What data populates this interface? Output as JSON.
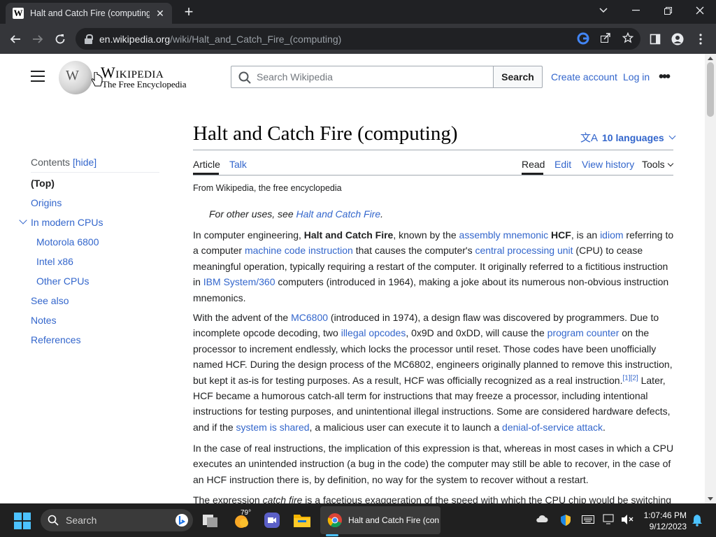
{
  "browser": {
    "tab_title": "Halt and Catch Fire (computing)",
    "tab_favicon": "W",
    "url_host": "en.wikipedia.org",
    "url_path": "/wiki/Halt_and_Catch_Fire_(computing)"
  },
  "wiki_header": {
    "wordmark": "Wikipedia",
    "tagline": "The Free Encyclopedia",
    "search_placeholder": "Search Wikipedia",
    "search_button": "Search",
    "create_account": "Create account",
    "log_in": "Log in",
    "more": "•••"
  },
  "toc": {
    "title": "Contents",
    "hide": "[hide]",
    "items": [
      "(Top)",
      "Origins",
      "In modern CPUs",
      "Motorola 6800",
      "Intel x86",
      "Other CPUs",
      "See also",
      "Notes",
      "References"
    ]
  },
  "article": {
    "title": "Halt and Catch Fire (computing)",
    "languages": "10 languages",
    "lang_icon": "文A",
    "tabs": {
      "article": "Article",
      "talk": "Talk",
      "read": "Read",
      "edit": "Edit",
      "history": "View history",
      "tools": "Tools"
    },
    "from_wikipedia": "From Wikipedia, the free encyclopedia",
    "hatnote_prefix": "For other uses, see ",
    "hatnote_link": "Halt and Catch Fire",
    "hatnote_suffix": ".",
    "p1": [
      {
        "t": "In computer engineering, "
      },
      {
        "t": "Halt and Catch Fire",
        "b": true
      },
      {
        "t": ", known by the "
      },
      {
        "t": "assembly mnemonic",
        "link": true
      },
      {
        "t": " "
      },
      {
        "t": "HCF",
        "b": true
      },
      {
        "t": ", is an "
      },
      {
        "t": "idiom",
        "link": true
      },
      {
        "t": " referring to a computer "
      },
      {
        "t": "machine code instruction",
        "link": true
      },
      {
        "t": " that causes the computer's "
      },
      {
        "t": "central processing unit",
        "link": true
      },
      {
        "t": " (CPU) to cease meaningful operation, typically requiring a restart of the computer. It originally referred to a fictitious instruction in "
      },
      {
        "t": "IBM System/360",
        "link": true
      },
      {
        "t": " computers (introduced in 1964), making a joke about its numerous non-obvious instruction mnemonics."
      }
    ],
    "p2": [
      {
        "t": "With the advent of the "
      },
      {
        "t": "MC6800",
        "link": true
      },
      {
        "t": " (introduced in 1974), a design flaw was discovered by programmers. Due to incomplete opcode decoding, two "
      },
      {
        "t": "illegal opcodes",
        "link": true
      },
      {
        "t": ", 0x9D and 0xDD, will cause the "
      },
      {
        "t": "program counter",
        "link": true
      },
      {
        "t": " on the processor to increment endlessly, which locks the processor until reset. Those codes have been unofficially named HCF. During the design process of the MC6802, engineers originally planned to remove this instruction, but kept it as-is for testing purposes. As a result, HCF was officially recognized as a real instruction."
      },
      {
        "t": "[1][2]",
        "sup": true
      },
      {
        "t": " Later, HCF became a humorous catch-all term for instructions that may freeze a processor, including intentional instructions for testing purposes, and unintentional illegal instructions. Some are considered hardware defects, and if the "
      },
      {
        "t": "system is shared",
        "link": true
      },
      {
        "t": ", a malicious user can execute it to launch a "
      },
      {
        "t": "denial-of-service attack",
        "link": true
      },
      {
        "t": "."
      }
    ],
    "p3": [
      {
        "t": "In the case of real instructions, the implication of this expression is that, whereas in most cases in which a CPU executes an unintended instruction (a bug in the code) the computer may still be able to recover, in the case of an HCF instruction there is, by definition, no way for the system to recover without a restart."
      }
    ],
    "p4": [
      {
        "t": "The expression "
      },
      {
        "t": "catch fire",
        "i": true
      },
      {
        "t": " is a facetious exaggeration of the speed with which the CPU chip would be switching"
      }
    ]
  },
  "taskbar": {
    "search_label": "Search",
    "weather_temp": "79°",
    "chrome_task_label": "Halt and Catch Fire (con",
    "time": "1:07:46 PM",
    "date": "9/12/2023"
  },
  "colors": {
    "link": "#3366cc",
    "text": "#202122",
    "chrome_dark": "#202124",
    "chrome_toolbar": "#35363a"
  }
}
